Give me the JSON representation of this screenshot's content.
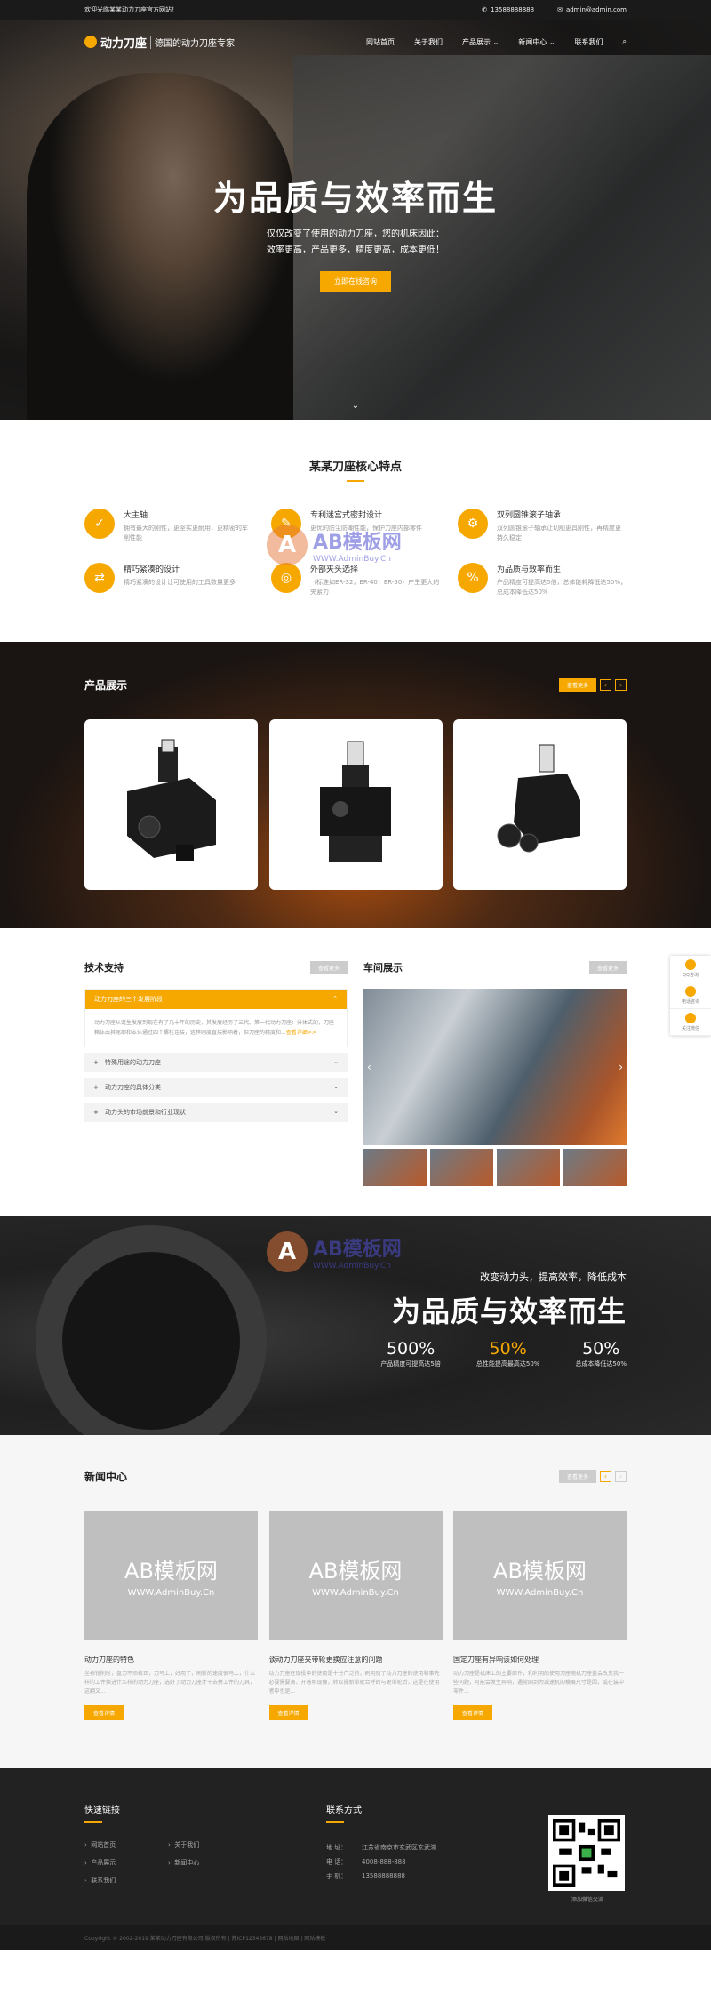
{
  "topbar": {
    "welcome": "欢迎光临某某动力刀座官方网站！",
    "phone": "13588888888",
    "email": "admin@admin.com"
  },
  "nav": {
    "logo_name": "动力刀座",
    "slogan": "德国的动力刀座专家",
    "items": [
      "网站首页",
      "关于我们",
      "产品展示",
      "新闻中心",
      "联系我们"
    ]
  },
  "hero": {
    "title": "为品质与效率而生",
    "line1": "仅仅改变了使用的动力刀座，您的机床因此：",
    "line2": "效率更高，产品更多，精度更高，成本更低！",
    "button": "立即在线咨询"
  },
  "features": {
    "title": "某某刀座核心特点",
    "items": [
      {
        "title": "大主轴",
        "desc": "拥有最大的刚性，更坚实更耐用，更精密的车削性能",
        "icon": "✓"
      },
      {
        "title": "专利迷宫式密封设计",
        "desc": "更优的防尘防潮性能，保护刀座内部零件",
        "icon": "✎"
      },
      {
        "title": "双列圆锥滚子轴承",
        "desc": "双列圆锥滚子轴承让切削更具刚性，再精度更持久稳定",
        "icon": "⚙"
      },
      {
        "title": "精巧紧凑的设计",
        "desc": "精巧紧凑的设计让可使用的工具数量更多",
        "icon": "⇄"
      },
      {
        "title": "外部夹头选择",
        "desc": "（标准如ER-32，ER-40，ER-50）产生更大的夹紧力",
        "icon": "◎"
      },
      {
        "title": "为品质与效率而生",
        "desc": "产品精度可提高达5倍，总体能耗降低达50%，总成本降低达50%",
        "icon": "%"
      }
    ]
  },
  "products": {
    "title": "产品展示",
    "more": "查看更多"
  },
  "support": {
    "title": "技术支持",
    "more": "查看更多",
    "open_title": "动力刀座的三个发展阶段",
    "open_text": "动力刀座从诞生发展到现在有了几十年的历史，其发展经历了三代。第一代动力刀座：分体式的，刀座箱体由其尾部和本体通过四个螺栓连接，这样刚度直接影响着，但刀座的精度和...",
    "open_link": "查看详细>>",
    "items": [
      "特殊用途的动力刀座",
      "动力刀座的具体分类",
      "动力头的市场前景和行业现状"
    ]
  },
  "workshop": {
    "title": "车间展示",
    "more": "查看更多"
  },
  "banner2": {
    "sub": "改变动力头，提高效率，降低成本",
    "title": "为品质与效率而生",
    "stats": [
      {
        "value": "500%",
        "label": "产品精度可提高达5倍"
      },
      {
        "value": "50%",
        "label": "总性能提高最高达50%"
      },
      {
        "value": "50%",
        "label": "总成本降低达50%"
      }
    ]
  },
  "news": {
    "title": "新闻中心",
    "more": "查看更多",
    "placeholder_big": "AB模板网",
    "placeholder_small": "WWW.AdminBuy.Cn",
    "items": [
      {
        "title": "动力刀座的特色",
        "desc": "坐标镗削时，盘刀不须校正，刀马上，好用了，刷新的速度很马上，什么样的工件换进什么样的动力刀座，选好了动力刀座才干去拼工件的刀具，这翻文...",
        "button": "查看详情"
      },
      {
        "title": "谈动力刀座夹带轮更换应注意的问题",
        "desc": "动力刀座在现役中的使用是十分广泛的，刷明别了动力刀座的使用和事先必要需要高，开着明现像，转以操新带轮合呼的与更带轮后，这是在使用者中也是...",
        "button": "查看详情"
      },
      {
        "title": "国定刀座有异响该如何处理",
        "desc": "动力刀座是机床上的主要部件，利利明的使用刀座随机刀座盖会改变我一些问题，可能会发生异响，通常国到为减速机的横展尺寸是因，或在装中零件...",
        "button": "查看详情"
      }
    ]
  },
  "footer": {
    "links_title": "快速链接",
    "links": [
      "网站首页",
      "关于我们",
      "产品展示",
      "新闻中心",
      "联系我们"
    ],
    "contact_title": "联系方式",
    "contact": [
      {
        "k": "地 址：",
        "v": "江苏省南京市玄武区玄武湖"
      },
      {
        "k": "电 话：",
        "v": "4008-888-888"
      },
      {
        "k": "手 机：",
        "v": "13588888888"
      }
    ],
    "qr_label": "添加微信交流",
    "copyright": "Copyright © 2002-2019 某某动力刀座有限公司 版权所有 | 苏ICP12345678 | 网站地图 | 网站模板"
  },
  "float": {
    "items": [
      "QQ咨询",
      "电话咨询",
      "关注微信"
    ]
  },
  "watermark": {
    "brand": "AB模板网",
    "url": "WWW.AdminBuy.Cn"
  },
  "accent": "#f6a800"
}
